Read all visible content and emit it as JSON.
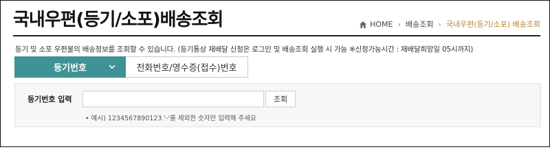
{
  "page_title": "국내우편(등기/소포)배송조회",
  "breadcrumb": {
    "home": "HOME",
    "level1": "배송조회",
    "current": "국내우편(등기/소포) 배송조회"
  },
  "description": "등기 및 소포 우편물의 배송정보를 조회할 수 있습니다. (등기통상 재배달 신청은 로그인 및 배송조회 실행 시 가능 ※신청가능시간 : 재배달희망일 05시까지)",
  "tabs": {
    "active": "등기번호",
    "inactive": "전화번호/영수증(접수)번호"
  },
  "form": {
    "label": "등기번호 입력",
    "input_value": "",
    "input_placeholder": "",
    "button": "조회",
    "hint": "• 예시) 1234567890123 '-'를 제외한 숫자만 입력해 주세요"
  },
  "colors": {
    "accent": "#3f9295",
    "breadcrumb_current": "#b8862b"
  },
  "icons": {
    "home": "home-icon",
    "chevron": "chevron-down-icon"
  }
}
